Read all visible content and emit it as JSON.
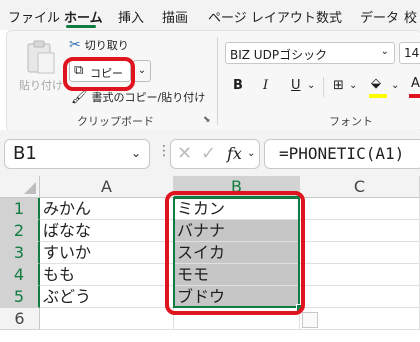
{
  "menu": {
    "tabs": [
      "ファイル",
      "ホーム",
      "挿入",
      "描画",
      "ページ レイアウト",
      "数式",
      "データ",
      "校"
    ]
  },
  "ribbon": {
    "paste_label": "貼り付け",
    "cut_label": "切り取り",
    "copy_label": "コピー",
    "format_painter_label": "書式のコピー/貼り付け",
    "clipboard_group_label": "クリップボード",
    "font_name": "BIZ UDPゴシック",
    "font_size": "14",
    "bold": "B",
    "italic": "I",
    "underline": "U",
    "font_group_label": "フォント",
    "font_color_letter": "A"
  },
  "formula_bar": {
    "name_box": "B1",
    "fx": "fx",
    "formula": "=PHONETIC(A1)"
  },
  "sheet": {
    "columns": [
      "A",
      "B",
      "C"
    ],
    "rows": [
      "1",
      "2",
      "3",
      "4",
      "5",
      "6"
    ],
    "col_a": [
      "みかん",
      "ばなな",
      "すいか",
      "もも",
      "ぶどう"
    ],
    "col_b": [
      "ミカン",
      "バナナ",
      "スイカ",
      "モモ",
      "ブドウ"
    ]
  },
  "colors": {
    "accent": "#107c41",
    "highlight_ring": "#e0141e",
    "fill_yellow": "#ffff00",
    "font_red": "#e0141e"
  }
}
